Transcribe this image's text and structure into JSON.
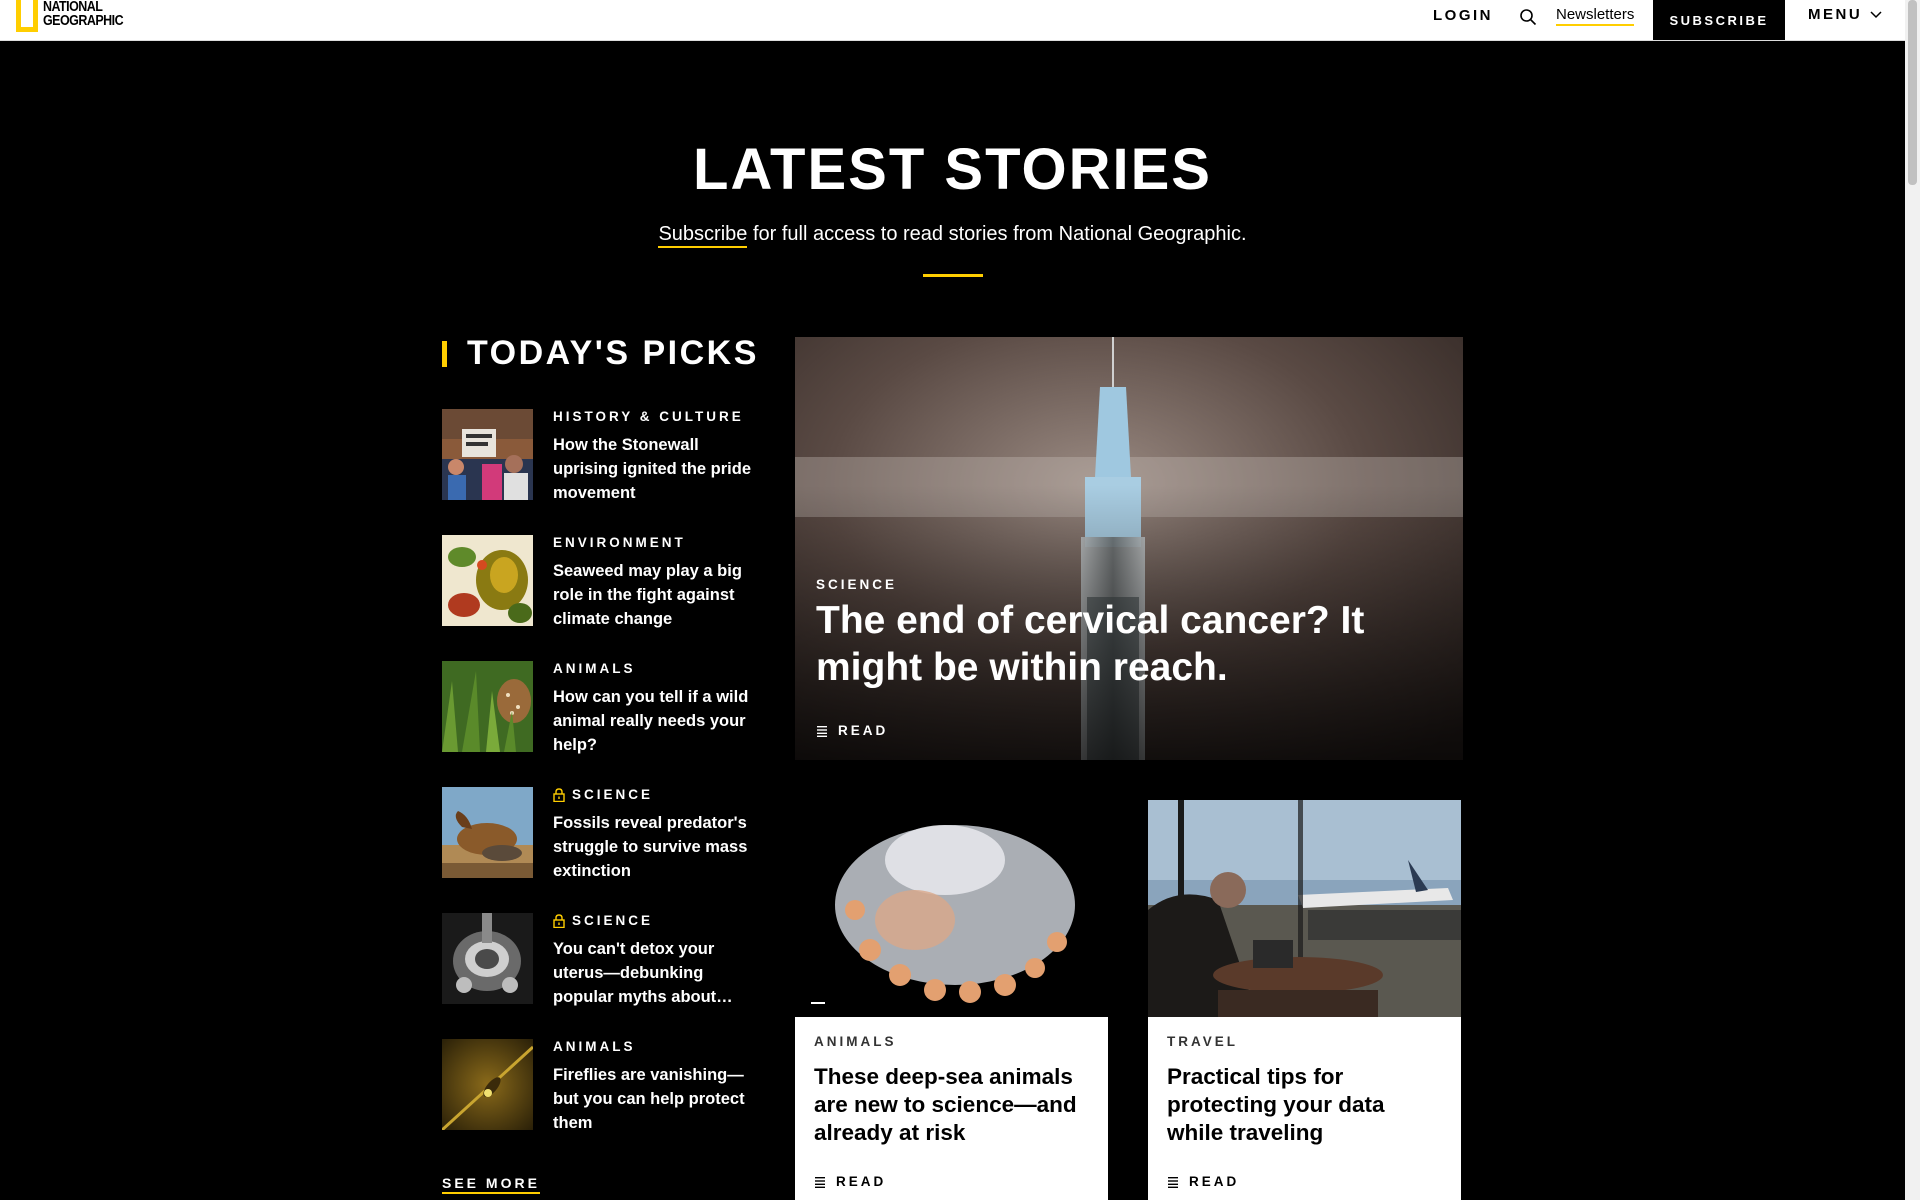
{
  "brand": {
    "logo_line1": "NATIONAL",
    "logo_line2": "GEOGRAPHIC"
  },
  "nav": {
    "login": "LOGIN",
    "newsletters": "Newsletters",
    "subscribe": "SUBSCRIBE",
    "menu": "MENU"
  },
  "header": {
    "title": "LATEST STORIES",
    "subscribe_link": "Subscribe",
    "subtitle_rest": " for full access to read stories from National Geographic."
  },
  "picks": {
    "heading": "TODAY'S PICKS",
    "items": [
      {
        "category": "HISTORY & CULTURE",
        "headline": "How the Stonewall uprising ignited the pride movement",
        "locked": false
      },
      {
        "category": "ENVIRONMENT",
        "headline": "Seaweed may play a big role in the fight against climate change",
        "locked": false
      },
      {
        "category": "ANIMALS",
        "headline": "How can you tell if a wild animal really needs your help?",
        "locked": false
      },
      {
        "category": "SCIENCE",
        "headline": "Fossils reveal predator's struggle to survive mass extinction",
        "locked": true
      },
      {
        "category": "SCIENCE",
        "headline": "You can't detox your uterus—debunking popular myths about PC...",
        "locked": true
      },
      {
        "category": "ANIMALS",
        "headline": "Fireflies are vanishing—but you can help protect them",
        "locked": false
      }
    ],
    "see_more": "SEE MORE"
  },
  "hero": {
    "category": "SCIENCE",
    "headline": "The end of cervical cancer? It might be within reach.",
    "read": "READ"
  },
  "cards": [
    {
      "category": "ANIMALS",
      "headline": "These deep-sea animals are new to science—and already at risk",
      "read": "READ"
    },
    {
      "category": "TRAVEL",
      "headline": "Practical tips for protecting your data while traveling",
      "read": "READ"
    }
  ],
  "colors": {
    "accent": "#ffce00",
    "background": "#000000",
    "nav_bg": "#ffffff"
  }
}
